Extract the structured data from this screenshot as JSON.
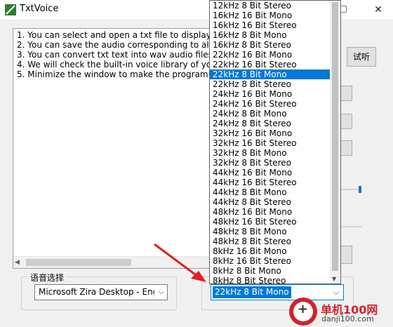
{
  "window": {
    "title": "TxtVoice"
  },
  "textarea": {
    "lines": [
      "1. You can select and open a txt file to display all t",
      "2. You can save the audio corresponding to all the",
      "3. You can convert txt text into wav audio files, s",
      "4. We will check the built-in voice library of your W",
      "5. Minimize the window to make the program wor"
    ]
  },
  "voice": {
    "group_label": "语音选择",
    "selected": "Microsoft Zira Desktop - Englis"
  },
  "format": {
    "selected": "22kHz 8 Bit Mono",
    "options": [
      "12kHz 8 Bit Stereo",
      "16kHz 16 Bit Mono",
      "16kHz 16 Bit Stereo",
      "16kHz 8 Bit Mono",
      "16kHz 8 Bit Stereo",
      "22kHz 16 Bit Mono",
      "22kHz 16 Bit Stereo",
      "22kHz 8 Bit Mono",
      "22kHz 8 Bit Stereo",
      "24kHz 16 Bit Mono",
      "24kHz 16 Bit Stereo",
      "24kHz 8 Bit Mono",
      "24kHz 8 Bit Stereo",
      "32kHz 16 Bit Mono",
      "32kHz 16 Bit Stereo",
      "32kHz 8 Bit Mono",
      "32kHz 8 Bit Stereo",
      "44kHz 16 Bit Mono",
      "44kHz 16 Bit Stereo",
      "44kHz 8 Bit Mono",
      "44kHz 8 Bit Stereo",
      "48kHz 16 Bit Mono",
      "48kHz 16 Bit Stereo",
      "48kHz 8 Bit Mono",
      "48kHz 8 Bit Stereo",
      "8kHz 16 Bit Mono",
      "8kHz 16 Bit Stereo",
      "8kHz 8 Bit Mono",
      "8kHz 8 Bit Stereo"
    ],
    "selected_index": 7
  },
  "buttons": {
    "listen_label": "试听"
  },
  "watermark": {
    "title": "单机100网",
    "url": "danji100.com"
  },
  "colors": {
    "accent": "#0078d7",
    "arrow": "#e02020",
    "brand": "#d2232a"
  }
}
